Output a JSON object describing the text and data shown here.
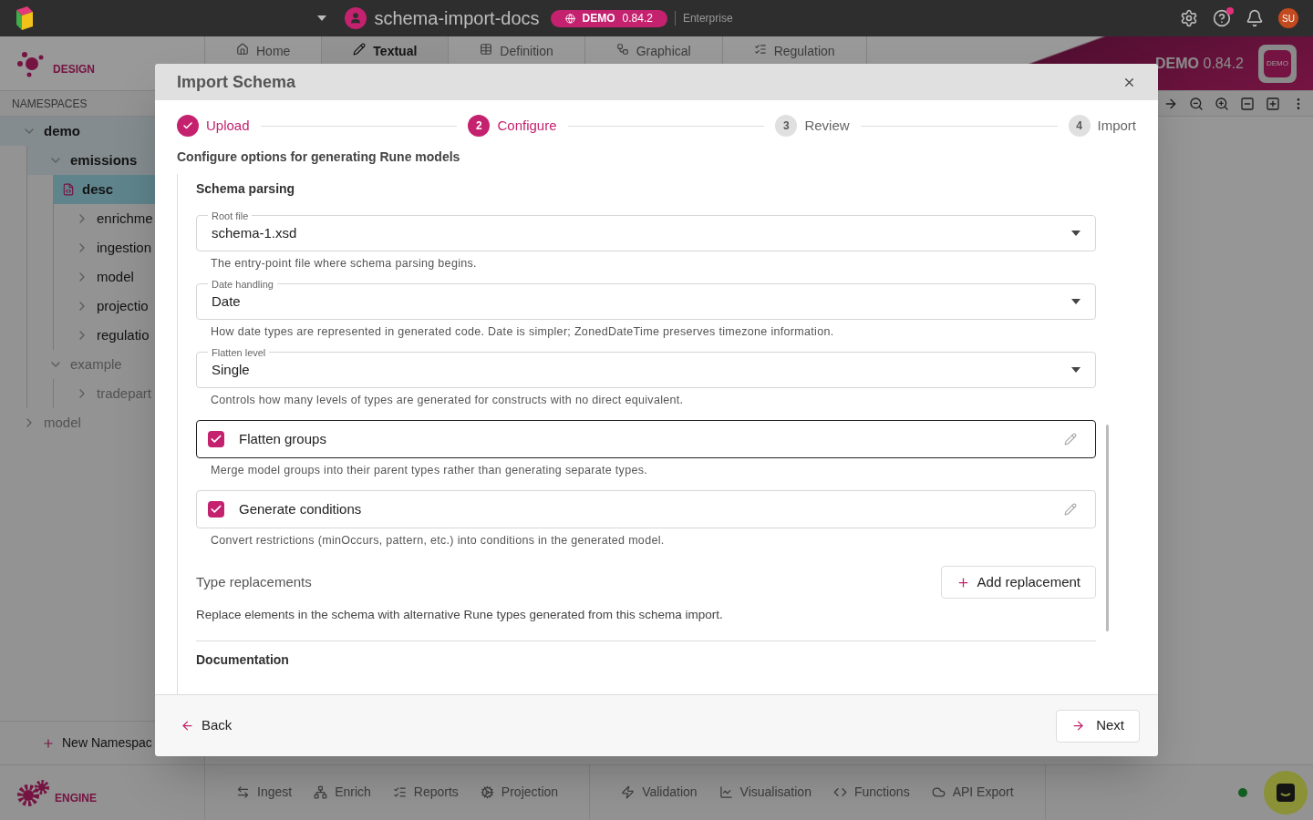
{
  "top_bar": {
    "project": "schema-import-docs",
    "badge_label": "DEMO",
    "badge_version": "0.84.2",
    "edition": "Enterprise",
    "avatar": "SU"
  },
  "design_header": {
    "label": "DESIGN"
  },
  "editor_tabs": [
    {
      "label": "Home",
      "selected": false
    },
    {
      "label": "Textual",
      "selected": true
    },
    {
      "label": "Definition",
      "selected": false
    },
    {
      "label": "Graphical",
      "selected": false
    },
    {
      "label": "Regulation",
      "selected": false
    }
  ],
  "banner": {
    "name": "DEMO",
    "version": "0.84.2",
    "logo_text": "DEMO"
  },
  "namespaces": {
    "title": "NAMESPACES",
    "tree": [
      {
        "label": "demo",
        "kind": "folder",
        "expanded": true,
        "selected": false,
        "on_path": true,
        "dimmed": false,
        "children": [
          {
            "label": "emissions",
            "kind": "folder",
            "expanded": true,
            "selected": false,
            "on_path": true,
            "dimmed": false,
            "children": [
              {
                "label": "desc",
                "kind": "file",
                "selected": true,
                "on_path": false,
                "dimmed": false
              },
              {
                "label": "enrichme",
                "kind": "folder",
                "expanded": false,
                "selected": false,
                "on_path": false,
                "dimmed": false
              },
              {
                "label": "ingestion",
                "kind": "folder",
                "expanded": false,
                "selected": false,
                "on_path": false,
                "dimmed": false
              },
              {
                "label": "model",
                "kind": "folder",
                "expanded": false,
                "selected": false,
                "on_path": false,
                "dimmed": false
              },
              {
                "label": "projectio",
                "kind": "folder",
                "expanded": false,
                "selected": false,
                "on_path": false,
                "dimmed": false
              },
              {
                "label": "regulatio",
                "kind": "folder",
                "expanded": false,
                "selected": false,
                "on_path": false,
                "dimmed": false
              }
            ]
          },
          {
            "label": "example",
            "kind": "folder",
            "expanded": true,
            "selected": false,
            "on_path": false,
            "dimmed": true,
            "children": [
              {
                "label": "tradepart",
                "kind": "folder",
                "expanded": false,
                "selected": false,
                "on_path": false,
                "dimmed": true
              }
            ]
          }
        ]
      },
      {
        "label": "model",
        "kind": "folder",
        "expanded": false,
        "selected": false,
        "on_path": false,
        "dimmed": true
      }
    ]
  },
  "new_namespace_button": "New Namespac",
  "engine_header": {
    "label": "ENGINE"
  },
  "bottom_tab_groups": [
    {
      "tabs": [
        "Ingest",
        "Enrich",
        "Reports",
        "Projection"
      ]
    },
    {
      "tabs": [
        "Validation",
        "Visualisation",
        "Functions",
        "API Export"
      ]
    }
  ],
  "modal": {
    "title": "Import Schema",
    "steps": [
      {
        "label": "Upload",
        "completed": true,
        "selected": false
      },
      {
        "number": "2",
        "label": "Configure",
        "completed": false,
        "selected": true
      },
      {
        "number": "3",
        "label": "Review",
        "completed": false,
        "selected": false
      },
      {
        "number": "4",
        "label": "Import",
        "completed": false,
        "selected": false
      }
    ],
    "subtitle": "Configure options for generating Rune models",
    "section_title": "Schema parsing",
    "settings": [
      {
        "kind": "select",
        "label": "Root file",
        "value": "schema-1.xsd",
        "help": "The entry-point file where schema parsing begins.",
        "focused": false
      },
      {
        "kind": "select",
        "label": "Date handling",
        "value": "Date",
        "help": "How date types are represented in generated code. Date is simpler; ZonedDateTime preserves timezone information.",
        "focused": false
      },
      {
        "kind": "select",
        "label": "Flatten level",
        "value": "Single",
        "help": "Controls how many levels of types are generated for constructs with no direct equivalent.",
        "focused": false
      },
      {
        "kind": "checkbox",
        "label": "Flatten groups",
        "checked": true,
        "help": "Merge model groups into their parent types rather than generating separate types.",
        "focused": true
      },
      {
        "kind": "checkbox",
        "label": "Generate conditions",
        "checked": true,
        "help": "Convert restrictions (minOccurs, pattern, etc.) into conditions in the generated model.",
        "focused": false
      }
    ],
    "type_replacements": {
      "label": "Type replacements",
      "button": "Add replacement",
      "description": "Replace elements in the schema with alternative Rune types generated from this schema import."
    },
    "next_section": "Documentation",
    "back_button": "Back",
    "next_button": "Next"
  }
}
